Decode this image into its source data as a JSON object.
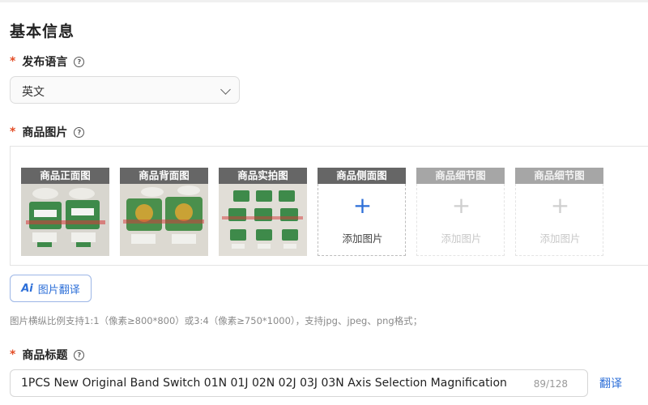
{
  "section": {
    "title": "基本信息"
  },
  "language": {
    "label": "发布语言",
    "value": "英文"
  },
  "images": {
    "label": "商品图片",
    "slots": [
      {
        "label": "商品正面图",
        "state": "filled"
      },
      {
        "label": "商品背面图",
        "state": "filled"
      },
      {
        "label": "商品实拍图",
        "state": "filled"
      },
      {
        "label": "商品侧面图",
        "state": "empty",
        "add_text": "添加图片"
      },
      {
        "label": "商品细节图",
        "state": "disabled",
        "add_text": "添加图片"
      },
      {
        "label": "商品细节图",
        "state": "disabled",
        "add_text": "添加图片"
      }
    ],
    "translate_button": "图片翻译",
    "translate_icon": "Ai",
    "hint": "图片横纵比例支持1:1（像素≥800*800）或3:4（像素≥750*1000），支持jpg、jpeg、png格式；"
  },
  "product_title": {
    "label": "商品标题",
    "value": "1PCS New Original Band Switch 01N 01J 02N 02J 03J 03N Axis Selection Magnification",
    "count": "89/128",
    "translate_link": "翻译"
  },
  "colors": {
    "accent": "#2d6fd8",
    "required": "#e34d26"
  }
}
